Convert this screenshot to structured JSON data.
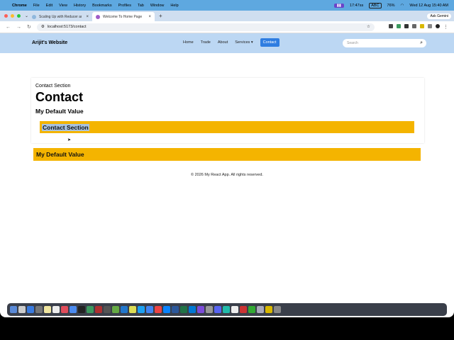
{
  "macos_menubar": {
    "app": "Chrome",
    "menus": [
      "File",
      "Edit",
      "View",
      "History",
      "Bookmarks",
      "Profiles",
      "Tab",
      "Window",
      "Help"
    ],
    "status_time": "17:47ss",
    "keyboard": "ABC",
    "battery": "76%",
    "datetime": "Wed 12 Aug  15:40 AM"
  },
  "browser": {
    "tabs": [
      {
        "title": "Scaling Up with Reducer and",
        "active": false
      },
      {
        "title": "Welcome To Home Page",
        "active": true
      }
    ],
    "ask_gemini": "Ask Gemini",
    "url": "localhost:5173/contact"
  },
  "site": {
    "brand": "Arijit's Website",
    "nav": [
      "Home",
      "Trade",
      "About",
      "Services"
    ],
    "nav_active": "Contact",
    "search_placeholder": "Search"
  },
  "main": {
    "subheading": "Contact Section",
    "title": "Contact",
    "default_value": "My Default Value",
    "band_contact": "Contact Section",
    "band_default": "My Default Value"
  },
  "footer": {
    "text": "© 2026 My React App. All rights reserved."
  },
  "colors": {
    "menubar": "#5ea8e0",
    "navbar": "#bcd7f3",
    "accent": "#2f7de1",
    "band": "#f4b400"
  }
}
